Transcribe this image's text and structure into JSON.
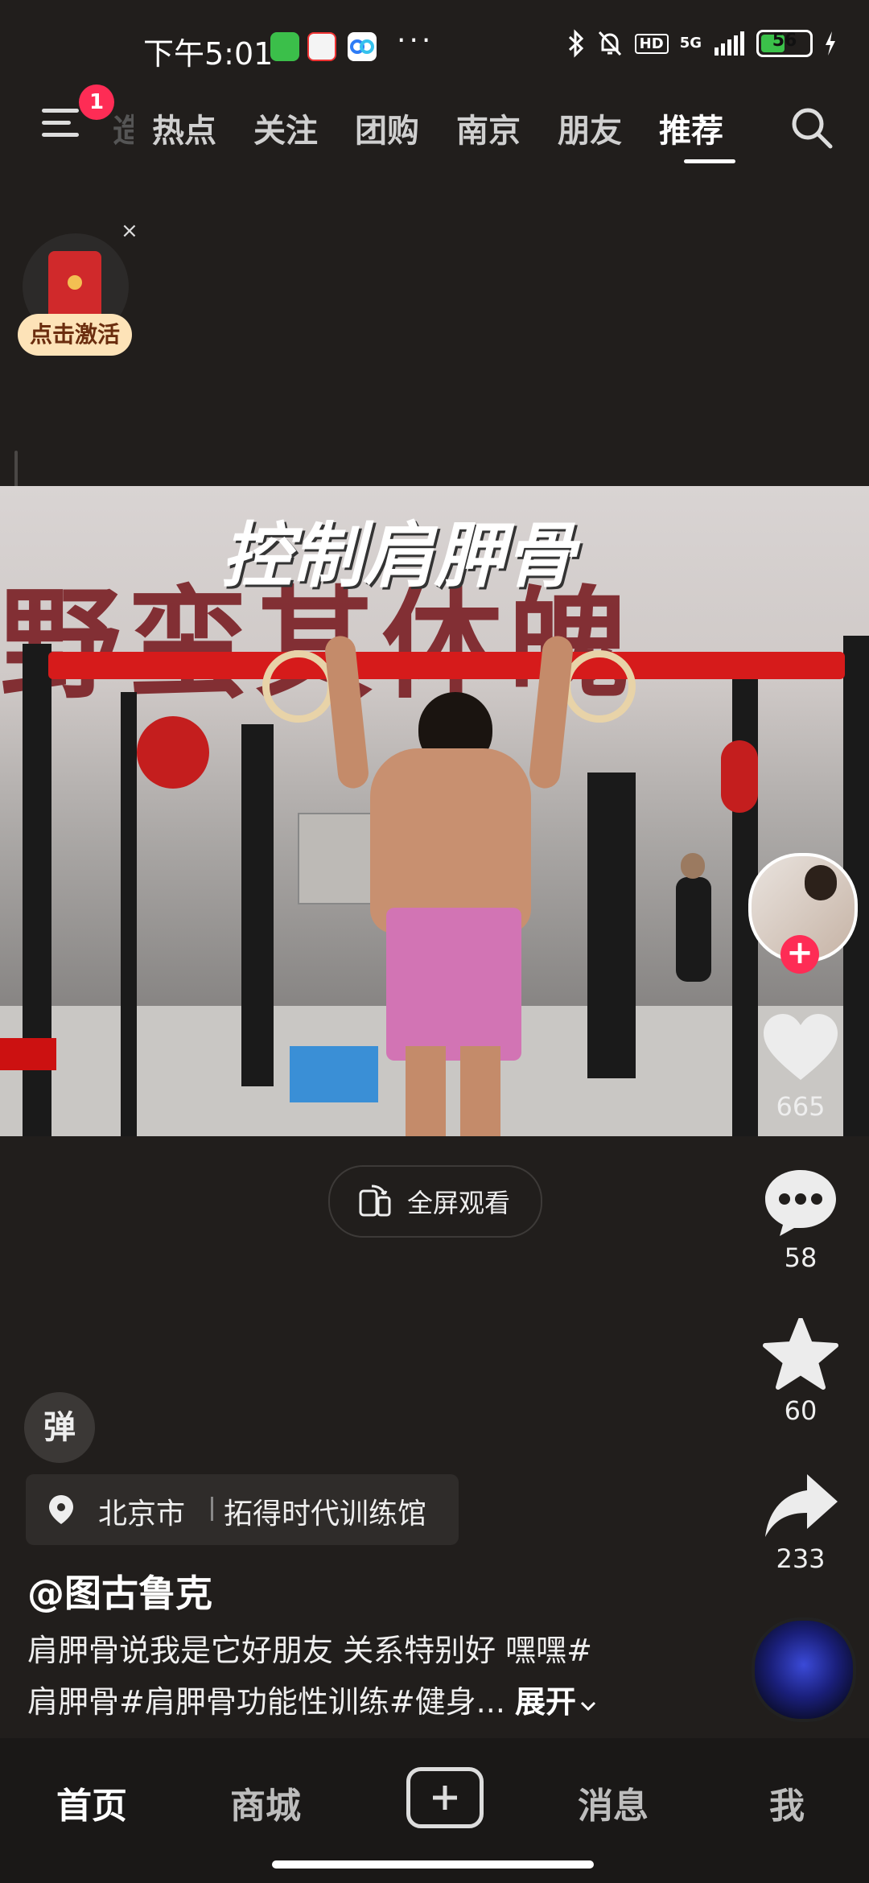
{
  "status_bar": {
    "time": "下午5:01",
    "network": "5G",
    "hd_badge": "HD",
    "battery": "56",
    "battery_level": 0.56,
    "app_icons": [
      "wechat-icon",
      "58-icon",
      "baidu-netdisk-icon"
    ],
    "more": "···"
  },
  "top_nav": {
    "menu_badge": "1",
    "partial_tab": "造",
    "tabs": [
      "热点",
      "关注",
      "团购",
      "南京",
      "朋友",
      "推荐"
    ],
    "active_tab": "推荐"
  },
  "red_packet": {
    "label": "点击激活",
    "close": "×",
    "coin": "¥"
  },
  "video": {
    "title_overlay": "控制肩胛骨",
    "wall_text": "野蛮其体魄"
  },
  "actions": {
    "likes": "665",
    "comments": "58",
    "favorites": "60",
    "shares": "233",
    "follow_plus": "+"
  },
  "fullscreen": {
    "label": "全屏观看"
  },
  "danmaku": {
    "label": "弹"
  },
  "location": {
    "city": "北京市",
    "place": "拓得时代训练馆"
  },
  "post": {
    "author": "@图古鲁克",
    "caption_line1": "肩胛骨说我是它好朋友 关系特别好 嘿嘿#",
    "caption_line2": "肩胛骨#肩胛骨功能性训练#健身...",
    "expand": "展开"
  },
  "bottom_nav": {
    "home": "首页",
    "mall": "商城",
    "messages": "消息",
    "me": "我",
    "active": "首页"
  }
}
